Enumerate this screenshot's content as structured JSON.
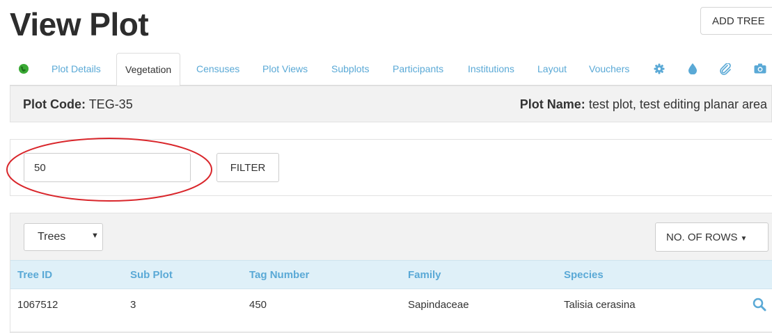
{
  "page": {
    "title": "View Plot",
    "add_tree_label": "ADD TREE"
  },
  "tabs": [
    {
      "label": "Plot Details",
      "active": false
    },
    {
      "label": "Vegetation",
      "active": true
    },
    {
      "label": "Censuses",
      "active": false
    },
    {
      "label": "Plot Views",
      "active": false
    },
    {
      "label": "Subplots",
      "active": false
    },
    {
      "label": "Participants",
      "active": false
    },
    {
      "label": "Institutions",
      "active": false
    },
    {
      "label": "Layout",
      "active": false
    },
    {
      "label": "Vouchers",
      "active": false
    }
  ],
  "tab_icons": [
    "globe-icon",
    "gear-icon",
    "water-drop-icon",
    "paperclip-icon",
    "camera-icon"
  ],
  "plot_info": {
    "code_label": "Plot Code:",
    "code_value": "TEG-35",
    "name_label": "Plot Name:",
    "name_value": "test plot, test editing planar area"
  },
  "filter": {
    "value": "50",
    "button_label": "FILTER"
  },
  "view_select": {
    "selected": "Trees"
  },
  "rows_button": {
    "label": "NO. OF ROWS"
  },
  "table": {
    "columns": [
      "Tree ID",
      "Sub Plot",
      "Tag Number",
      "Family",
      "Species"
    ],
    "rows": [
      {
        "tree_id": "1067512",
        "sub_plot": "3",
        "tag_number": "450",
        "family": "Sapindaceae",
        "species": "Talisia cerasina"
      }
    ]
  },
  "colors": {
    "link_blue": "#5aa9d6",
    "header_bg": "#dff0f8",
    "panel_bg": "#f2f2f2",
    "annotation_red": "#d9262b",
    "status_green": "#3aa935"
  }
}
